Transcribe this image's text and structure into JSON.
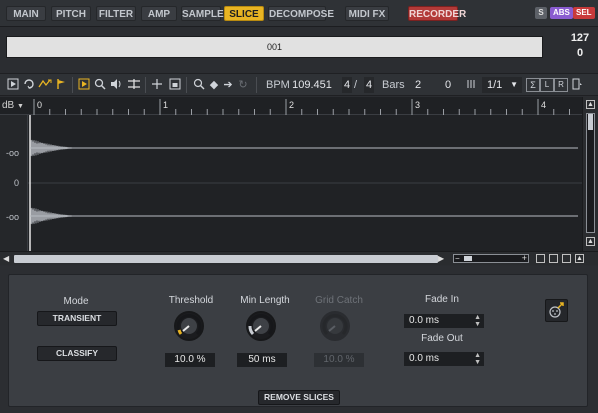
{
  "tabs": [
    "MAIN",
    "PITCH",
    "FILTER",
    "AMP",
    "SAMPLE",
    "SLICE",
    "DECOMPOSE",
    "MIDI FX",
    "RECORDER"
  ],
  "active_tab": "SLICE",
  "header_badges": {
    "s_icon": "S",
    "abs": "ABS",
    "sel": "SEL"
  },
  "slice_name": "001",
  "velocity": "127",
  "slice_value": "0",
  "toolbar": {
    "bpm_label": "BPM",
    "bpm_value": "109.451",
    "sig_num": "4",
    "sig_sep": "/",
    "sig_den": "4",
    "bars_label": "Bars",
    "bars_value": "2",
    "offset_value": "0",
    "grid_value": "1/1",
    "grid_dropdown_icon": "chevron-down-icon",
    "sigma_label": "Σ",
    "l_label": "L",
    "r_label": "R"
  },
  "ruler": {
    "unit": "dB",
    "markers": [
      "0",
      "1",
      "2",
      "3",
      "4"
    ]
  },
  "wave_labels": [
    "-oo",
    "0",
    "-oo",
    "-oo",
    "0",
    "-oo"
  ],
  "panel": {
    "mode_label": "Mode",
    "mode_value": "TRANSIENT",
    "classify_label": "CLASSIFY",
    "threshold_label": "Threshold",
    "threshold_value": "10.0 %",
    "threshold_level": 0.1,
    "min_length_label": "Min Length",
    "min_length_value": "50 ms",
    "grid_catch_label": "Grid Catch",
    "grid_catch_value": "10.0 %",
    "fade_in_label": "Fade In",
    "fade_in_value": "0.0 ms",
    "fade_out_label": "Fade Out",
    "fade_out_value": "0.0 ms",
    "remove_slices_label": "REMOVE SLICES"
  },
  "colors": {
    "accent": "#e8b423",
    "recorder": "#b23a38",
    "abs": "#8a5cd0",
    "sel": "#c83a3a",
    "waveform": "#b8bcc2"
  }
}
